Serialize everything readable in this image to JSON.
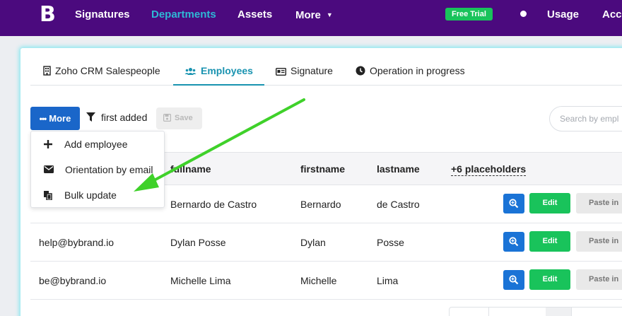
{
  "nav": {
    "logo": "B",
    "items": [
      "Signatures",
      "Departments",
      "Assets",
      "More"
    ],
    "trial_badge": "Free Trial",
    "usage": "Usage",
    "account": "Acc"
  },
  "tabs": [
    "Zoho CRM Salespeople",
    "Employees",
    "Signature",
    "Operation in progress"
  ],
  "toolbar": {
    "more_label": "More",
    "filter_label": "first added",
    "save_label": "Save",
    "search_placeholder": "Search by empl"
  },
  "menu": {
    "items": [
      "Add employee",
      "Orientation by email",
      "Bulk update"
    ]
  },
  "table": {
    "headers": [
      "fullname",
      "firstname",
      "lastname",
      "+6 placeholders"
    ],
    "rows": [
      {
        "email": "",
        "fullname": "Bernardo de Castro",
        "firstname": "Bernardo",
        "lastname": "de Castro"
      },
      {
        "email": "help@bybrand.io",
        "fullname": "Dylan Posse",
        "firstname": "Dylan",
        "lastname": "Posse"
      },
      {
        "email": "be@bybrand.io",
        "fullname": "Michelle Lima",
        "firstname": "Michelle",
        "lastname": "Lima"
      }
    ],
    "edit_label": "Edit",
    "paste_label": "Paste in"
  },
  "colors": {
    "nav_bg": "#4b0a7e",
    "nav_active": "#2eb8d6",
    "primary": "#1a66c9",
    "success": "#19c35b",
    "tab_active": "#1993b0",
    "annotation_arrow": "#3fd12a"
  }
}
